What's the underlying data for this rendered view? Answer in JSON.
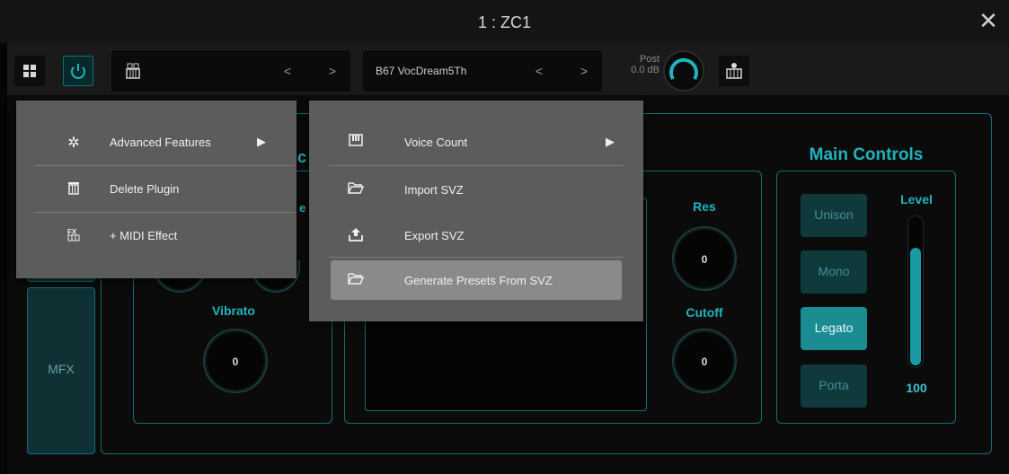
{
  "window": {
    "title": "1 : ZC1",
    "close_glyph": "✕"
  },
  "toolbar": {
    "preset_left": "",
    "preset_right": "B67 VocDream5Th",
    "prev_glyph": "<",
    "next_glyph": ">",
    "output_label": "Post",
    "output_value": "0.0 dB",
    "icons": [
      "grid-icon",
      "power-icon",
      "plugin-icon",
      "keyboard-icon"
    ]
  },
  "sidebar": {
    "mfx_label": "MFX"
  },
  "sections": {
    "vibrato_label": "Vibrato",
    "vibrato_value": "0",
    "res_label": "Res",
    "res_value": "0",
    "cutoff_label": "Cutoff",
    "cutoff_value": "0",
    "partial_title_fragment": "c",
    "partial_label_fragment": "e"
  },
  "main_controls": {
    "title": "Main Controls",
    "level_label": "Level",
    "level_value": "100",
    "level_fill_fraction": 0.8,
    "buttons": [
      {
        "label": "Unison",
        "active": false
      },
      {
        "label": "Mono",
        "active": false
      },
      {
        "label": "Legato",
        "active": true
      },
      {
        "label": "Porta",
        "active": false
      }
    ]
  },
  "menu1": {
    "items": [
      {
        "label": "Advanced Features",
        "icon": "gear-icon",
        "submenu": "▶"
      },
      {
        "label": "Delete Plugin",
        "icon": "trash-icon"
      },
      {
        "label": "+ MIDI Effect",
        "icon": "fx-icon"
      }
    ]
  },
  "menu2": {
    "items": [
      {
        "label": "Voice Count",
        "icon": "piano-icon",
        "submenu": "▶"
      },
      {
        "label": "Import SVZ",
        "icon": "folder-open-icon"
      },
      {
        "label": "Export SVZ",
        "icon": "export-icon"
      },
      {
        "label": "Generate Presets From SVZ",
        "icon": "folder-open-icon",
        "highlighted": true
      }
    ]
  },
  "colors": {
    "accent": "#1fb4bd",
    "border": "#0f6f76",
    "menu_bg": "#5c5c5c",
    "highlight": "#8a8a8a"
  }
}
